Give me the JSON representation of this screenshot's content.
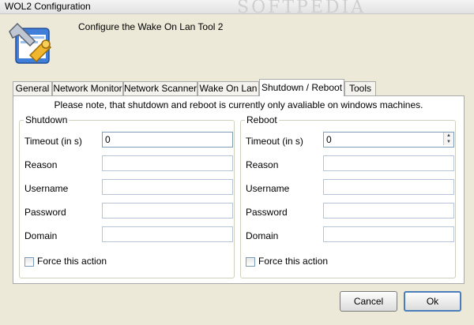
{
  "window": {
    "title": "WOL2 Configuration",
    "watermark": "SOFTPEDIA"
  },
  "header": {
    "description": "Configure the Wake On Lan Tool 2"
  },
  "tabs": [
    {
      "label": "General"
    },
    {
      "label": "Network Monitor"
    },
    {
      "label": "Network Scanner"
    },
    {
      "label": "Wake On Lan"
    },
    {
      "label": "Shutdown / Reboot",
      "active": true
    },
    {
      "label": "Tools"
    }
  ],
  "panel": {
    "note": "Please note, that shutdown and reboot is currently only avaliable on windows machines."
  },
  "shutdown": {
    "title": "Shutdown",
    "timeout_label": "Timeout (in s)",
    "timeout_value": "0",
    "reason_label": "Reason",
    "reason_value": "",
    "username_label": "Username",
    "username_value": "",
    "password_label": "Password",
    "password_value": "",
    "domain_label": "Domain",
    "domain_value": "",
    "force_label": "Force this action"
  },
  "reboot": {
    "title": "Reboot",
    "timeout_label": "Timeout (in s)",
    "timeout_value": "0",
    "reason_label": "Reason",
    "reason_value": "",
    "username_label": "Username",
    "username_value": "",
    "password_label": "Password",
    "password_value": "",
    "domain_label": "Domain",
    "domain_value": "",
    "force_label": "Force this action"
  },
  "buttons": {
    "cancel": "Cancel",
    "ok": "Ok"
  },
  "icons": {
    "header": "config-tools-icon",
    "spin_up": "▲",
    "spin_down": "▼"
  }
}
